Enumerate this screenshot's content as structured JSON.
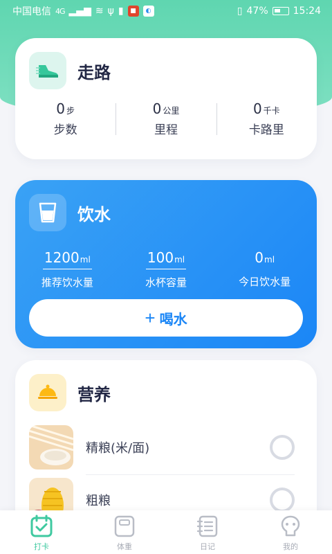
{
  "status_bar": {
    "carrier": "中国电信",
    "network": "4G",
    "battery_percent": "47%",
    "time": "15:24"
  },
  "walk": {
    "title": "走路",
    "icon": "shoe-icon",
    "stats": [
      {
        "value": "0",
        "unit": "步",
        "label": "步数"
      },
      {
        "value": "0",
        "unit": "公里",
        "label": "里程"
      },
      {
        "value": "0",
        "unit": "千卡",
        "label": "卡路里"
      }
    ]
  },
  "water": {
    "title": "饮水",
    "icon": "cup-icon",
    "stats": [
      {
        "value": "1200",
        "unit": "ml",
        "label": "推荐饮水量"
      },
      {
        "value": "100",
        "unit": "ml",
        "label": "水杯容量"
      },
      {
        "value": "0",
        "unit": "ml",
        "label": "今日饮水量"
      }
    ],
    "button_plus": "+",
    "button_label": "喝水"
  },
  "nutrition": {
    "title": "营养",
    "icon": "cloche-icon",
    "items": [
      {
        "name": "精粮(米/面)",
        "icon": "rice-noodle-icon"
      },
      {
        "name": "粗粮",
        "icon": "corn-icon"
      }
    ]
  },
  "tabs": [
    {
      "label": "打卡",
      "icon": "calendar-check-icon",
      "active": true
    },
    {
      "label": "体重",
      "icon": "scale-icon",
      "active": false
    },
    {
      "label": "日记",
      "icon": "notebook-icon",
      "active": false
    },
    {
      "label": "我的",
      "icon": "profile-icon",
      "active": false
    }
  ],
  "colors": {
    "accent_green": "#3fc9a0",
    "water_blue": "#1b86f6",
    "nutrition_yellow": "#fdb913"
  }
}
